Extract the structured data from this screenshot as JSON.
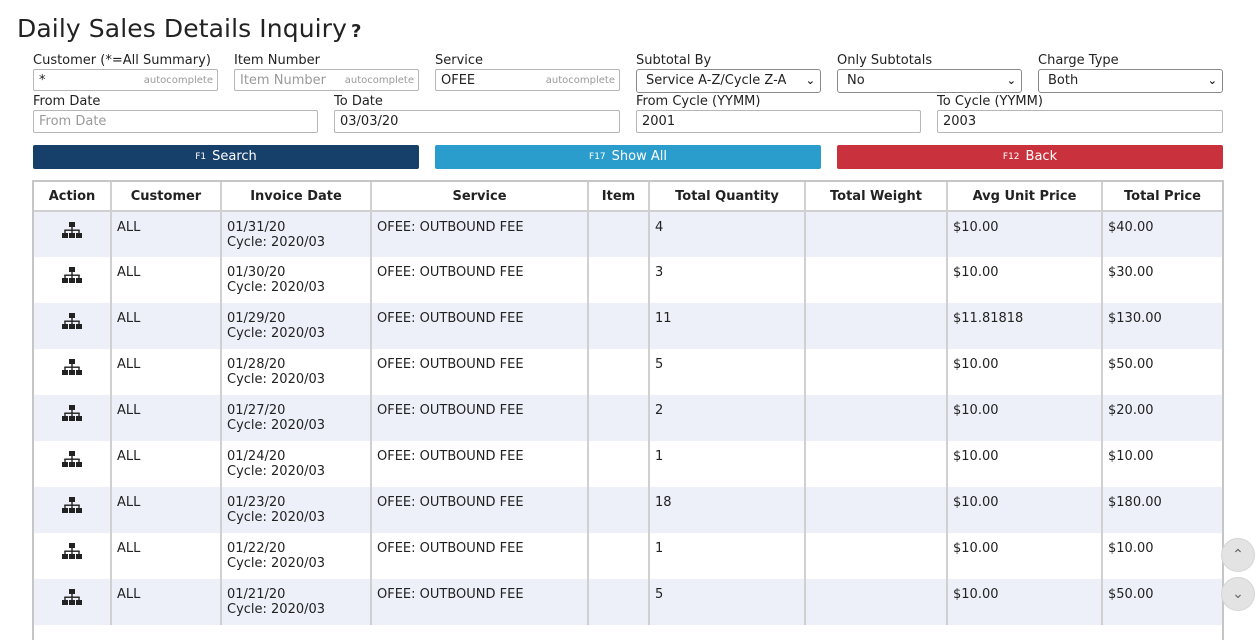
{
  "page": {
    "title": "Daily Sales Details Inquiry",
    "help_glyph": "?"
  },
  "filters": {
    "customer": {
      "label": "Customer (*=All Summary)",
      "value": "*",
      "hint": "autocomplete"
    },
    "item_number": {
      "label": "Item Number",
      "placeholder": "Item Number",
      "value": "",
      "hint": "autocomplete"
    },
    "service": {
      "label": "Service",
      "value": "OFEE",
      "hint": "autocomplete"
    },
    "subtotal_by": {
      "label": "Subtotal By",
      "value": "Service A-Z/Cycle Z-A"
    },
    "only_subtotals": {
      "label": "Only Subtotals",
      "value": "No"
    },
    "charge_type": {
      "label": "Charge Type",
      "value": "Both"
    },
    "from_date": {
      "label": "From Date",
      "placeholder": "From Date",
      "value": ""
    },
    "to_date": {
      "label": "To Date",
      "value": "03/03/20"
    },
    "from_cycle": {
      "label": "From Cycle (YYMM)",
      "value": "2001"
    },
    "to_cycle": {
      "label": "To Cycle (YYMM)",
      "value": "2003"
    }
  },
  "buttons": {
    "search": {
      "key": "F1",
      "label": "Search"
    },
    "show_all": {
      "key": "F17",
      "label": "Show All"
    },
    "back": {
      "key": "F12",
      "label": "Back"
    }
  },
  "colors": {
    "search": "#163f6a",
    "show_all": "#2b9dcc",
    "back": "#c9323d",
    "row_alt": "#eef0f9"
  },
  "table": {
    "columns": [
      "Action",
      "Customer",
      "Invoice Date",
      "Service",
      "Item",
      "Total Quantity",
      "Total Weight",
      "Avg Unit Price",
      "Total Price"
    ],
    "rows": [
      {
        "customer": "ALL",
        "date": "01/31/20",
        "cycle": "Cycle: 2020/03",
        "service": "OFEE: OUTBOUND FEE",
        "item": "",
        "qty": "4",
        "weight": "",
        "avg": "$10.00",
        "total": "$40.00"
      },
      {
        "customer": "ALL",
        "date": "01/30/20",
        "cycle": "Cycle: 2020/03",
        "service": "OFEE: OUTBOUND FEE",
        "item": "",
        "qty": "3",
        "weight": "",
        "avg": "$10.00",
        "total": "$30.00"
      },
      {
        "customer": "ALL",
        "date": "01/29/20",
        "cycle": "Cycle: 2020/03",
        "service": "OFEE: OUTBOUND FEE",
        "item": "",
        "qty": "11",
        "weight": "",
        "avg": "$11.81818",
        "total": "$130.00"
      },
      {
        "customer": "ALL",
        "date": "01/28/20",
        "cycle": "Cycle: 2020/03",
        "service": "OFEE: OUTBOUND FEE",
        "item": "",
        "qty": "5",
        "weight": "",
        "avg": "$10.00",
        "total": "$50.00"
      },
      {
        "customer": "ALL",
        "date": "01/27/20",
        "cycle": "Cycle: 2020/03",
        "service": "OFEE: OUTBOUND FEE",
        "item": "",
        "qty": "2",
        "weight": "",
        "avg": "$10.00",
        "total": "$20.00"
      },
      {
        "customer": "ALL",
        "date": "01/24/20",
        "cycle": "Cycle: 2020/03",
        "service": "OFEE: OUTBOUND FEE",
        "item": "",
        "qty": "1",
        "weight": "",
        "avg": "$10.00",
        "total": "$10.00"
      },
      {
        "customer": "ALL",
        "date": "01/23/20",
        "cycle": "Cycle: 2020/03",
        "service": "OFEE: OUTBOUND FEE",
        "item": "",
        "qty": "18",
        "weight": "",
        "avg": "$10.00",
        "total": "$180.00"
      },
      {
        "customer": "ALL",
        "date": "01/22/20",
        "cycle": "Cycle: 2020/03",
        "service": "OFEE: OUTBOUND FEE",
        "item": "",
        "qty": "1",
        "weight": "",
        "avg": "$10.00",
        "total": "$10.00"
      },
      {
        "customer": "ALL",
        "date": "01/21/20",
        "cycle": "Cycle: 2020/03",
        "service": "OFEE: OUTBOUND FEE",
        "item": "",
        "qty": "5",
        "weight": "",
        "avg": "$10.00",
        "total": "$50.00"
      }
    ]
  },
  "row_action_icon": "sitemap-icon",
  "scroll_controls": {
    "up_icon": "chevron-up-icon",
    "down_icon": "chevron-down-icon"
  }
}
